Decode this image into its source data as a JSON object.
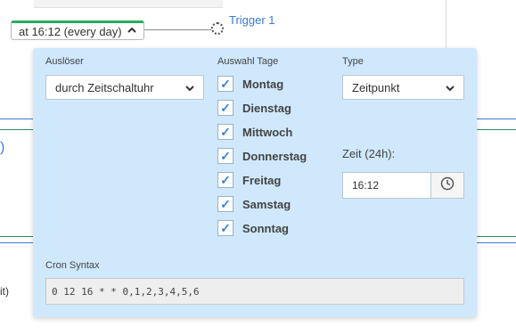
{
  "canvas": {
    "trigger_chip_label": "at 16:12 (every day)",
    "trigger_chip_chevron": "^",
    "trigger_link": "Trigger 1",
    "left_fragment_1": ")",
    "left_fragment_2": "it)"
  },
  "panel": {
    "trigger_label": "Auslöser",
    "trigger_select": "durch Zeitschaltuhr",
    "days_label": "Auswahl Tage",
    "days": [
      {
        "label": "Montag",
        "checked": true
      },
      {
        "label": "Dienstag",
        "checked": true
      },
      {
        "label": "Mittwoch",
        "checked": true
      },
      {
        "label": "Donnerstag",
        "checked": true
      },
      {
        "label": "Freitag",
        "checked": true
      },
      {
        "label": "Samstag",
        "checked": true
      },
      {
        "label": "Sonntag",
        "checked": true
      }
    ],
    "type_label": "Type",
    "type_select": "Zeitpunkt",
    "time_label": "Zeit (24h):",
    "time_value": "16:12",
    "cron_label": "Cron Syntax",
    "cron_value": "0 12 16 * * 0,1,2,3,4,5,6"
  },
  "colors": {
    "panel_bg": "#cfe8fc",
    "accent_green": "#27ae60",
    "link_blue": "#3a7bd5",
    "check_blue": "#3c82d6"
  },
  "icons": {
    "chip_chevron": "chevron-up-icon",
    "select_arrow": "chevron-down-icon",
    "checkbox": "checkmark-icon",
    "time_button": "clock-icon",
    "port": "connector-port-icon"
  }
}
